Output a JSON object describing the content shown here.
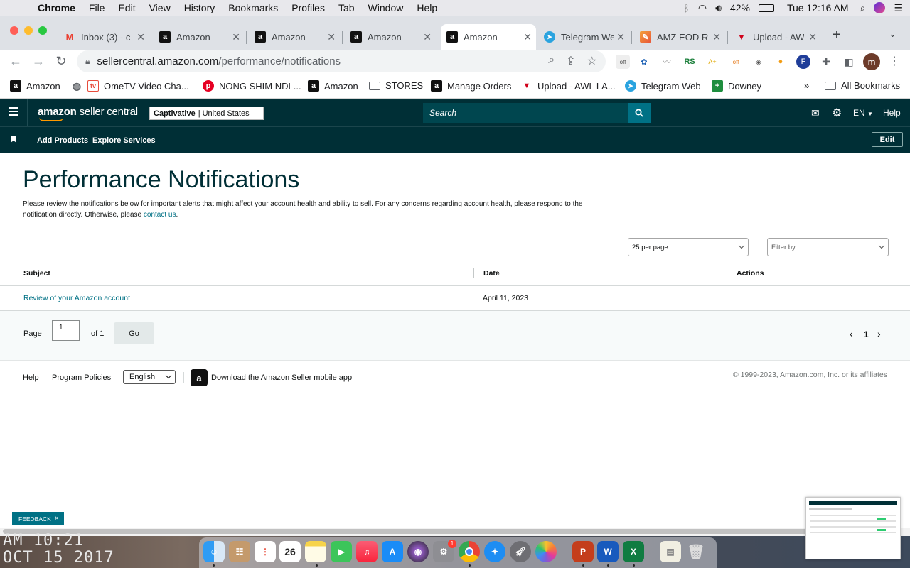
{
  "menubar": {
    "app": "Chrome",
    "items": [
      "File",
      "Edit",
      "View",
      "History",
      "Bookmarks",
      "Profiles",
      "Tab",
      "Window",
      "Help"
    ],
    "battery": "42%",
    "clock": "Tue 12:16 AM"
  },
  "tabs": [
    {
      "title": "Inbox (3) - c",
      "favicon": "gmail-icon",
      "color": "#ea4335"
    },
    {
      "title": "Amazon",
      "favicon": "amazon-icon",
      "color": "#111111"
    },
    {
      "title": "Amazon",
      "favicon": "amazon-icon",
      "color": "#111111"
    },
    {
      "title": "Amazon",
      "favicon": "amazon-icon",
      "color": "#111111"
    },
    {
      "title": "Amazon",
      "favicon": "amazon-icon",
      "color": "#111111",
      "active": true
    },
    {
      "title": "Telegram We",
      "favicon": "telegram-icon",
      "color": "#2aa3df"
    },
    {
      "title": "AMZ EOD Re",
      "favicon": "amz-eod-icon",
      "color": "#e8553a"
    },
    {
      "title": "Upload - AW",
      "favicon": "upload-icon",
      "color": "#d0021b"
    }
  ],
  "url": {
    "host": "sellercentral.amazon.com",
    "path": "/performance/notifications"
  },
  "profile_initial": "m",
  "bookmarks": [
    {
      "label": "Amazon",
      "icon": "amazon-icon"
    },
    {
      "label": "OmeTV Video Cha...",
      "icon": "ometv-icon"
    },
    {
      "label": "NONG SHIM NDL...",
      "icon": "pinterest-icon"
    },
    {
      "label": "Amazon",
      "icon": "amazon-icon"
    },
    {
      "label": "STORES",
      "icon": "folder-icon"
    },
    {
      "label": "Manage Orders",
      "icon": "amazon-icon"
    },
    {
      "label": "Upload - AWL LA...",
      "icon": "upload-icon"
    },
    {
      "label": "Telegram Web",
      "icon": "telegram-icon"
    },
    {
      "label": "Downey",
      "icon": "sheets-icon"
    }
  ],
  "bookmarks_more": "»",
  "all_bookmarks": "All Bookmarks",
  "header": {
    "logo_main": "amazon",
    "logo_sub": "seller central",
    "store_name": "Captivative",
    "store_region": "| United States",
    "search_placeholder": "Search",
    "lang": "EN",
    "help": "Help"
  },
  "subnav": {
    "links": [
      "Add Products",
      "Explore Services"
    ],
    "edit": "Edit"
  },
  "page": {
    "title": "Performance Notifications",
    "desc": "Please review the notifications below for important alerts that might affect your account health and ability to sell. For any concerns regarding account health, please respond to the notification directly. Otherwise, please ",
    "contact_link": "contact us",
    "desc_end": "."
  },
  "filters": {
    "per_page": "25 per page",
    "filter_by": "Filter by"
  },
  "table": {
    "columns": [
      "Subject",
      "Date",
      "Actions"
    ],
    "rows": [
      {
        "subject": "Review of your Amazon account",
        "date": "April 11, 2023",
        "actions": ""
      }
    ]
  },
  "pager": {
    "page_label": "Page",
    "page_value": "1",
    "of_label": "of 1",
    "go": "Go",
    "current": "1"
  },
  "footer": {
    "help": "Help",
    "policies": "Program Policies",
    "language": "English",
    "app_text": "Download the Amazon Seller mobile app",
    "copyright": "© 1999-2023, Amazon.com, Inc. or its affiliates"
  },
  "feedback": "FEEDBACK",
  "desktop_text": {
    "line1": "AM 10:21",
    "line2": "OCT 15 2017"
  },
  "dock_calendar_day": "26",
  "dock_badge": "1"
}
